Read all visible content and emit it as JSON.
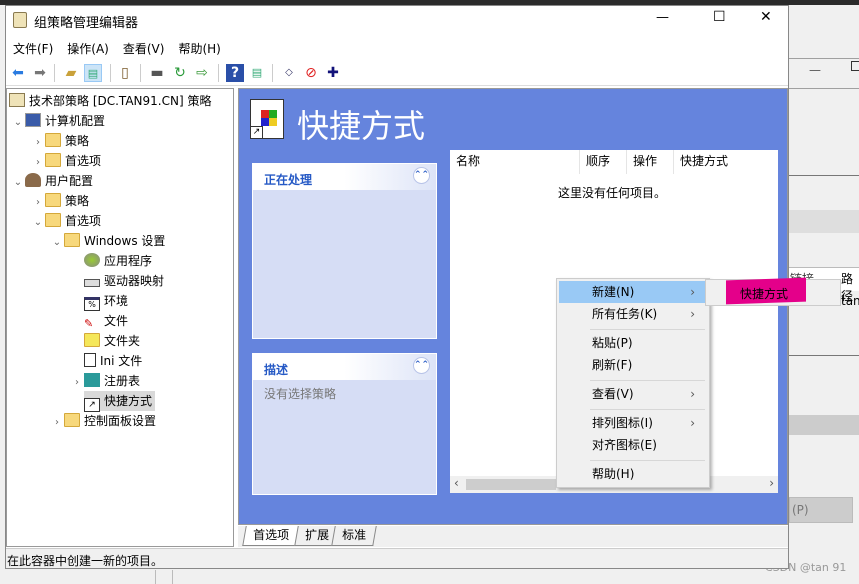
{
  "window": {
    "title": "组策略管理编辑器",
    "controls": {
      "minimize": "—",
      "maximize": "☐",
      "close": "✕"
    }
  },
  "menu": [
    "文件(F)",
    "操作(A)",
    "查看(V)",
    "帮助(H)"
  ],
  "toolbar": [
    "back-icon",
    "forward-icon",
    "up-folder-icon",
    "show-hide-tree-icon",
    "properties-icon",
    "print-icon",
    "refresh-icon",
    "export-icon",
    "help-icon",
    "show-action-pane-icon",
    "xml-icon",
    "stop-icon",
    "add-icon"
  ],
  "tree": {
    "root": "技术部策略 [DC.TAN91.CN] 策略",
    "computer": "计算机配置",
    "computer_policy": "策略",
    "computer_prefs": "首选项",
    "user": "用户配置",
    "user_policy": "策略",
    "user_prefs": "首选项",
    "windows_settings": "Windows 设置",
    "items": [
      "应用程序",
      "驱动器映射",
      "环境",
      "文件",
      "文件夹",
      "Ini 文件",
      "注册表",
      "快捷方式"
    ],
    "control_panel": "控制面板设置"
  },
  "content": {
    "title": "快捷方式",
    "processing_title": "正在处理",
    "description_title": "描述",
    "description_text": "没有选择策略",
    "columns": [
      "名称",
      "顺序",
      "操作",
      "快捷方式"
    ],
    "empty_text": "这里没有任何项目。"
  },
  "context_menu": {
    "items": [
      {
        "label": "新建(N)",
        "submenu": true
      },
      {
        "label": "所有任务(K)",
        "submenu": true
      },
      {
        "label": "粘贴(P)"
      },
      {
        "label": "刷新(F)"
      },
      {
        "label": "查看(V)",
        "submenu": true
      },
      {
        "label": "排列图标(I)",
        "submenu": true
      },
      {
        "label": "对齐图标(E)"
      },
      {
        "label": "帮助(H)"
      }
    ],
    "submenu": [
      "快捷方式"
    ],
    "highlight_color": "#e4008a"
  },
  "tabs": [
    "首选项",
    "扩展",
    "标准"
  ],
  "status": "在此容器中创建一新的项目。",
  "background_window": {
    "col1": "链接",
    "col2": "路径",
    "cell": "tan",
    "button": "(P)"
  },
  "watermark": "CSDN @tan 91",
  "colors": {
    "accent": "#6584dd",
    "menu_highlight": "#99c9f5"
  }
}
